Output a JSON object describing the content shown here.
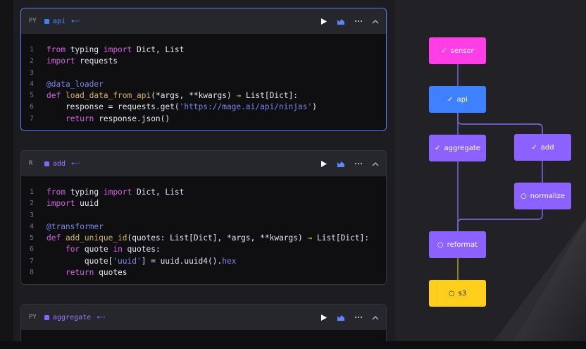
{
  "blocks": [
    {
      "lang": "PY",
      "name": "api",
      "color": "#3f80ff",
      "lines": [
        [
          {
            "t": "from",
            "c": "kw"
          },
          {
            "t": " typing ",
            "c": "txt"
          },
          {
            "t": "import",
            "c": "kw"
          },
          {
            "t": " Dict, List",
            "c": "txt"
          }
        ],
        [
          {
            "t": "import",
            "c": "kw"
          },
          {
            "t": " requests",
            "c": "txt"
          }
        ],
        [],
        [
          {
            "t": "@data_loader",
            "c": "dec"
          }
        ],
        [
          {
            "t": "def",
            "c": "kw"
          },
          {
            "t": " ",
            "c": "txt"
          },
          {
            "t": "load_data_from_api",
            "c": "fn"
          },
          {
            "t": "(*args, **kwargs) ",
            "c": "txt"
          },
          {
            "t": "→",
            "c": "arrow"
          },
          {
            "t": " List[Dict]:",
            "c": "txt"
          }
        ],
        [
          {
            "t": "    response = requests.get(",
            "c": "txt"
          },
          {
            "t": "'https://mage.ai/api/ninjas'",
            "c": "str"
          },
          {
            "t": ")",
            "c": "txt"
          }
        ],
        [
          {
            "t": "    ",
            "c": "txt"
          },
          {
            "t": "return",
            "c": "kw"
          },
          {
            "t": " response.json()",
            "c": "txt"
          }
        ]
      ]
    },
    {
      "lang": "R",
      "name": "add",
      "color": "#8b62ff",
      "lines": [
        [
          {
            "t": "from",
            "c": "kw"
          },
          {
            "t": " typing ",
            "c": "txt"
          },
          {
            "t": "import",
            "c": "kw"
          },
          {
            "t": " Dict, List",
            "c": "txt"
          }
        ],
        [
          {
            "t": "import",
            "c": "kw"
          },
          {
            "t": " uuid",
            "c": "txt"
          }
        ],
        [],
        [
          {
            "t": "@transformer",
            "c": "dec"
          }
        ],
        [
          {
            "t": "def",
            "c": "kw"
          },
          {
            "t": " ",
            "c": "txt"
          },
          {
            "t": "add_unique_id",
            "c": "fn"
          },
          {
            "t": "(quotes: List[Dict], *args, **kwargs) ",
            "c": "txt"
          },
          {
            "t": "→",
            "c": "arrow"
          },
          {
            "t": " List[Dict]:",
            "c": "txt"
          }
        ],
        [
          {
            "t": "    ",
            "c": "txt"
          },
          {
            "t": "for",
            "c": "kw"
          },
          {
            "t": " quote ",
            "c": "txt"
          },
          {
            "t": "in",
            "c": "kw"
          },
          {
            "t": " quotes:",
            "c": "txt"
          }
        ],
        [
          {
            "t": "        quote[",
            "c": "txt"
          },
          {
            "t": "'uuid'",
            "c": "str"
          },
          {
            "t": "] = uuid.uuid4().",
            "c": "txt"
          },
          {
            "t": "hex",
            "c": "method"
          }
        ],
        [
          {
            "t": "    ",
            "c": "txt"
          },
          {
            "t": "return",
            "c": "kw"
          },
          {
            "t": " quotes",
            "c": "txt"
          }
        ]
      ]
    },
    {
      "lang": "PY",
      "name": "aggregate",
      "color": "#8b62ff",
      "lines": []
    }
  ],
  "graph": {
    "nodes": {
      "sensor": {
        "label": "sensor",
        "status": "done"
      },
      "api": {
        "label": "api",
        "status": "done"
      },
      "aggregate": {
        "label": "aggregate",
        "status": "done"
      },
      "add": {
        "label": "add",
        "status": "done"
      },
      "normalize": {
        "label": "normalize",
        "status": "pending"
      },
      "reformat": {
        "label": "reformat",
        "status": "pending"
      },
      "s3": {
        "label": "s3",
        "status": "pending"
      }
    },
    "colors": {
      "sensor": "#ff3ee8",
      "api": "#3f80ff",
      "transformer": "#8b62ff",
      "exporter": "#ffcf1c",
      "edge": "#7d6ef0"
    }
  }
}
